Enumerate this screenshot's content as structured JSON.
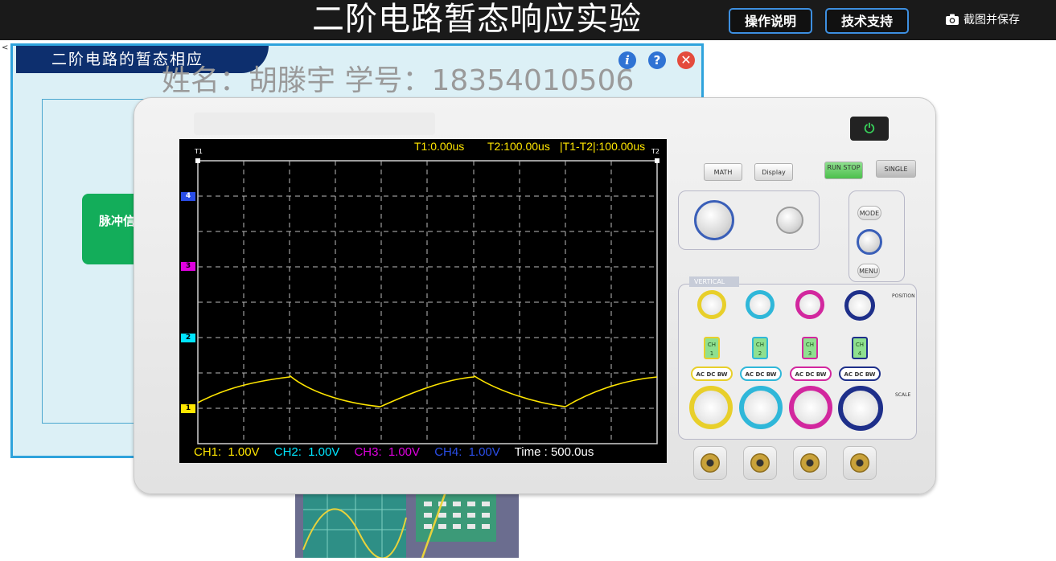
{
  "header": {
    "title": "二阶电路暂态响应实验",
    "buttons": {
      "guide": "操作说明",
      "support": "技术支持"
    },
    "screenshot_label": "截图并保存"
  },
  "left_mark": "<",
  "panel": {
    "title": "二阶电路的暂态相应",
    "student_info": "姓名：胡滕宇 学号：18354010506",
    "pulse_block_label": "脉冲信号"
  },
  "scope": {
    "cursor": {
      "t1": "T1:0.00us",
      "t2": "T2:100.00us",
      "delta": "|T1-T2|:100.00us"
    },
    "cursor_tags": {
      "t1": "T1",
      "t2": "T2"
    },
    "channels": [
      {
        "name": "CH1:",
        "scale": "1.00V",
        "color": "#ffe600",
        "marker": "1"
      },
      {
        "name": "CH2:",
        "scale": "1.00V",
        "color": "#00e5ff",
        "marker": "2"
      },
      {
        "name": "CH3:",
        "scale": "1.00V",
        "color": "#e000e0",
        "marker": "3"
      },
      {
        "name": "CH4:",
        "scale": "1.00V",
        "color": "#2a4ee8",
        "marker": "4"
      }
    ],
    "timebase": "Time : 500.0us",
    "buttons": {
      "math": "MATH",
      "display": "Display",
      "run_stop": "RUN STOP",
      "single": "SINGLE",
      "mode": "MODE",
      "menu": "MENU"
    },
    "section_labels": {
      "vertical": "VERTICAL",
      "position": "POSITION",
      "scale": "SCALE"
    },
    "ch_button_labels": [
      "CH 1",
      "CH 2",
      "CH 3",
      "CH 4"
    ],
    "coupling_label": "AC DC BW",
    "trace_color": "#ffe600"
  }
}
